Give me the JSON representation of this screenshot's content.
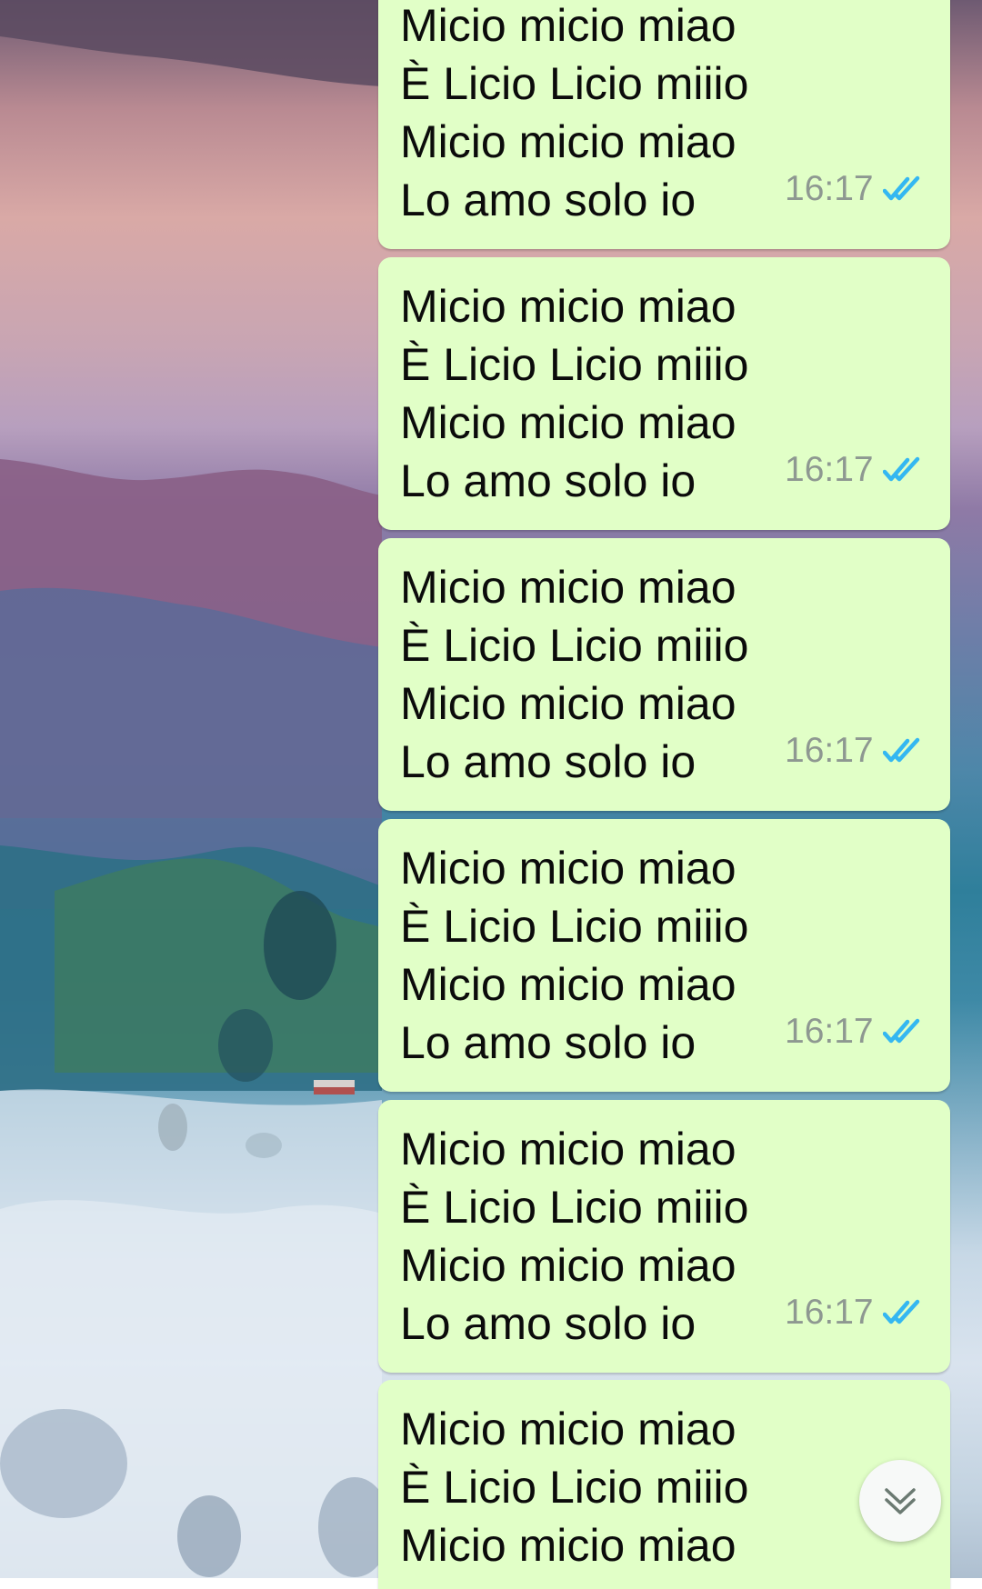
{
  "chat": {
    "messages": [
      {
        "lines": [
          "Micio micio miao",
          "È Licio Licio miiio",
          "Micio micio miao",
          "Lo amo solo io"
        ],
        "time": "16:17",
        "status_icon": "double-check-read-icon"
      },
      {
        "lines": [
          "Micio micio miao",
          "È Licio Licio miiio",
          "Micio micio miao",
          "Lo amo solo io"
        ],
        "time": "16:17",
        "status_icon": "double-check-read-icon"
      },
      {
        "lines": [
          "Micio micio miao",
          "È Licio Licio miiio",
          "Micio micio miao",
          "Lo amo solo io"
        ],
        "time": "16:17",
        "status_icon": "double-check-read-icon"
      },
      {
        "lines": [
          "Micio micio miao",
          "È Licio Licio miiio",
          "Micio micio miao",
          "Lo amo solo io"
        ],
        "time": "16:17",
        "status_icon": "double-check-read-icon"
      },
      {
        "lines": [
          "Micio micio miao",
          "È Licio Licio miiio",
          "Micio micio miao",
          "Lo amo solo io"
        ],
        "time": "16:17",
        "status_icon": "double-check-read-icon"
      },
      {
        "lines": [
          "Micio micio miao",
          "È Licio Licio miiio",
          "Micio micio miao"
        ],
        "time": "",
        "status_icon": ""
      }
    ]
  },
  "scroll_button": {
    "icon": "double-chevron-down-icon"
  },
  "colors": {
    "outgoing_bubble": "#e1ffc7",
    "message_text": "#0b0b0b",
    "timestamp": "#8e9891",
    "read_ticks": "#34b7f1"
  }
}
